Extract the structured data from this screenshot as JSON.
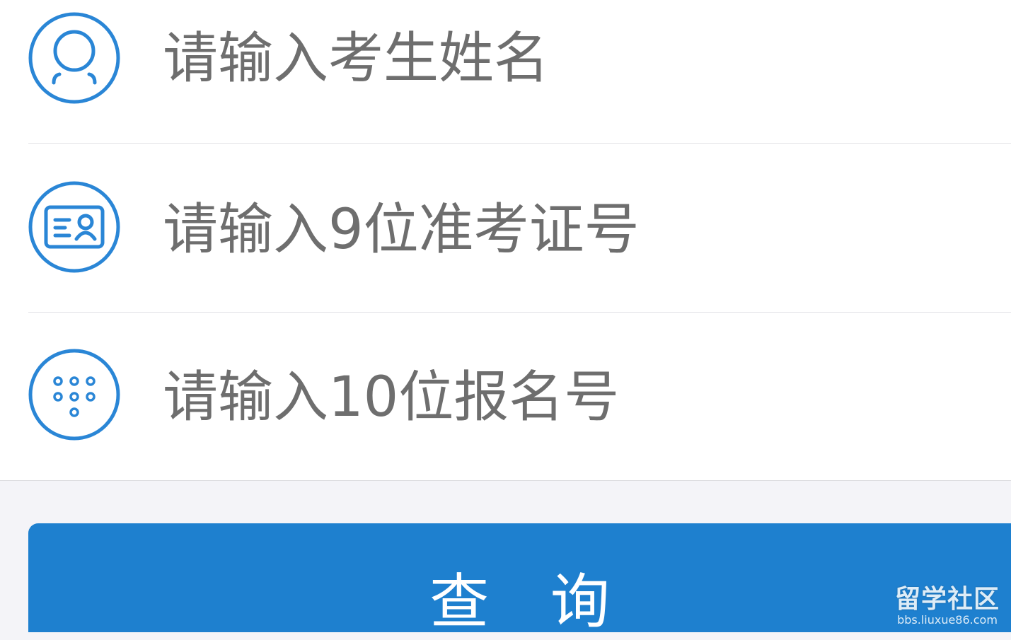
{
  "form": {
    "fields": [
      {
        "placeholder": "请输入考生姓名",
        "icon": "user-icon",
        "value": ""
      },
      {
        "placeholder": "请输入9位准考证号",
        "icon": "id-card-icon",
        "value": ""
      },
      {
        "placeholder": "请输入10位报名号",
        "icon": "keypad-icon",
        "value": ""
      }
    ]
  },
  "actions": {
    "query_label": "查 询"
  },
  "watermark": {
    "title": "留学社区",
    "url": "bbs.liuxue86.com"
  },
  "colors": {
    "accent": "#1e80cf",
    "icon_stroke": "#2a86d6",
    "placeholder_text": "#6e6e6e",
    "page_background": "#f4f4f8"
  }
}
